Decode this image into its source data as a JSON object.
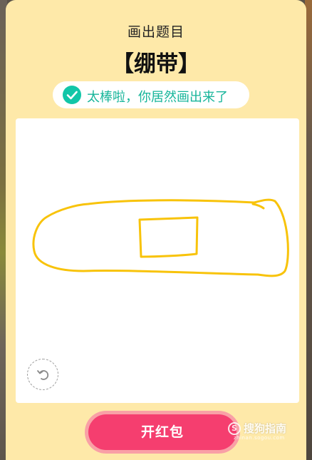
{
  "modal": {
    "subtitle": "画出题目",
    "word": "【绷带】",
    "result_text": "太棒啦，你居然画出来了",
    "open_button_label": "开红包"
  },
  "icons": {
    "check": "check-icon",
    "undo": "undo-icon"
  },
  "watermark": {
    "name": "搜狗指南",
    "url": "zhinan.sogou.com"
  },
  "colors": {
    "modal_background": "#fee9a9",
    "accent_green": "#12c6a8",
    "stroke_yellow": "#f8c30a",
    "button_pink": "#f53e6f",
    "button_glow": "#f9a0a6"
  }
}
